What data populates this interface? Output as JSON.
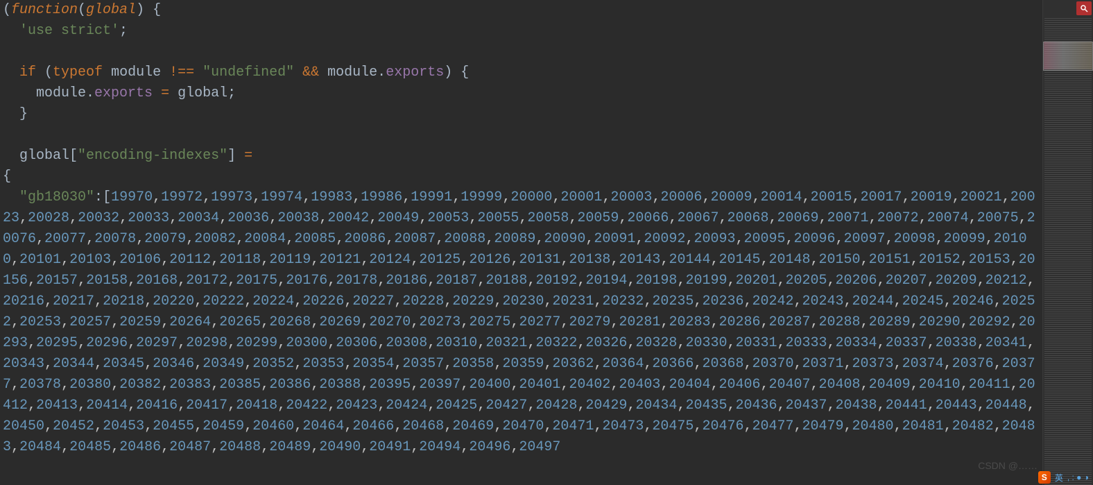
{
  "code": {
    "line1_pre": "(",
    "kw_function": "function",
    "line1_open": "(",
    "param_global": "global",
    "line1_close": ") {",
    "use_strict": "'use strict'",
    "semicolon": ";",
    "kw_if": "if",
    "if_open": " (",
    "kw_typeof": "typeof",
    "sp": " ",
    "ident_module": "module",
    "op_ne": " !== ",
    "str_undefined": "\"undefined\"",
    "op_and": " && ",
    "dot": ".",
    "ident_exports": "exports",
    "if_close": ") {",
    "assign": " = ",
    "ident_global": "global",
    "close_brace": "}",
    "bracket_open": "[",
    "str_encoding_indexes": "\"encoding-indexes\"",
    "bracket_close": "]",
    "eq": " =",
    "open_brace": "{",
    "key_gb18030": "\"gb18030\"",
    "colon": ":",
    "arr_open": "[",
    "numbers": "19970,19972,19973,19974,19983,19986,19991,19999,20000,20001,20003,20006,20009,20014,20015,20017,20019,20021,20023,20028,20032,20033,20034,20036,20038,20042,20049,20053,20055,20058,20059,20066,20067,20068,20069,20071,20072,20074,20075,20076,20077,20078,20079,20082,20084,20085,20086,20087,20088,20089,20090,20091,20092,20093,20095,20096,20097,20098,20099,20100,20101,20103,20106,20112,20118,20119,20121,20124,20125,20126,20131,20138,20143,20144,20145,20148,20150,20151,20152,20153,20156,20157,20158,20168,20172,20175,20176,20178,20186,20187,20188,20192,20194,20198,20199,20201,20205,20206,20207,20209,20212,20216,20217,20218,20220,20222,20224,20226,20227,20228,20229,20230,20231,20232,20235,20236,20242,20243,20244,20245,20246,20252,20253,20257,20259,20264,20265,20268,20269,20270,20273,20275,20277,20279,20281,20283,20286,20287,20288,20289,20290,20292,20293,20295,20296,20297,20298,20299,20300,20306,20308,20310,20321,20322,20326,20328,20330,20331,20333,20334,20337,20338,20341,20343,20344,20345,20346,20349,20352,20353,20354,20357,20358,20359,20362,20364,20366,20368,20370,20371,20373,20374,20376,20377,20378,20380,20382,20383,20385,20386,20388,20395,20397,20400,20401,20402,20403,20404,20406,20407,20408,20409,20410,20411,20412,20413,20414,20416,20417,20418,20422,20423,20424,20425,20427,20428,20429,20434,20435,20436,20437,20438,20441,20443,20448,20450,20452,20453,20455,20459,20460,20464,20466,20468,20469,20470,20471,20473,20475,20476,20477,20479,20480,20481,20482,20483,20484,20485,20486,20487,20488,20489,20490,20491,20494,20496,20497"
  },
  "minimap": {
    "search_icon": "search-icon"
  },
  "watermark": "CSDN @……",
  "taskbar": {
    "ime_logo": "S",
    "ime_lang": "英",
    "icons": ", : ● ◑",
    "time": ""
  }
}
